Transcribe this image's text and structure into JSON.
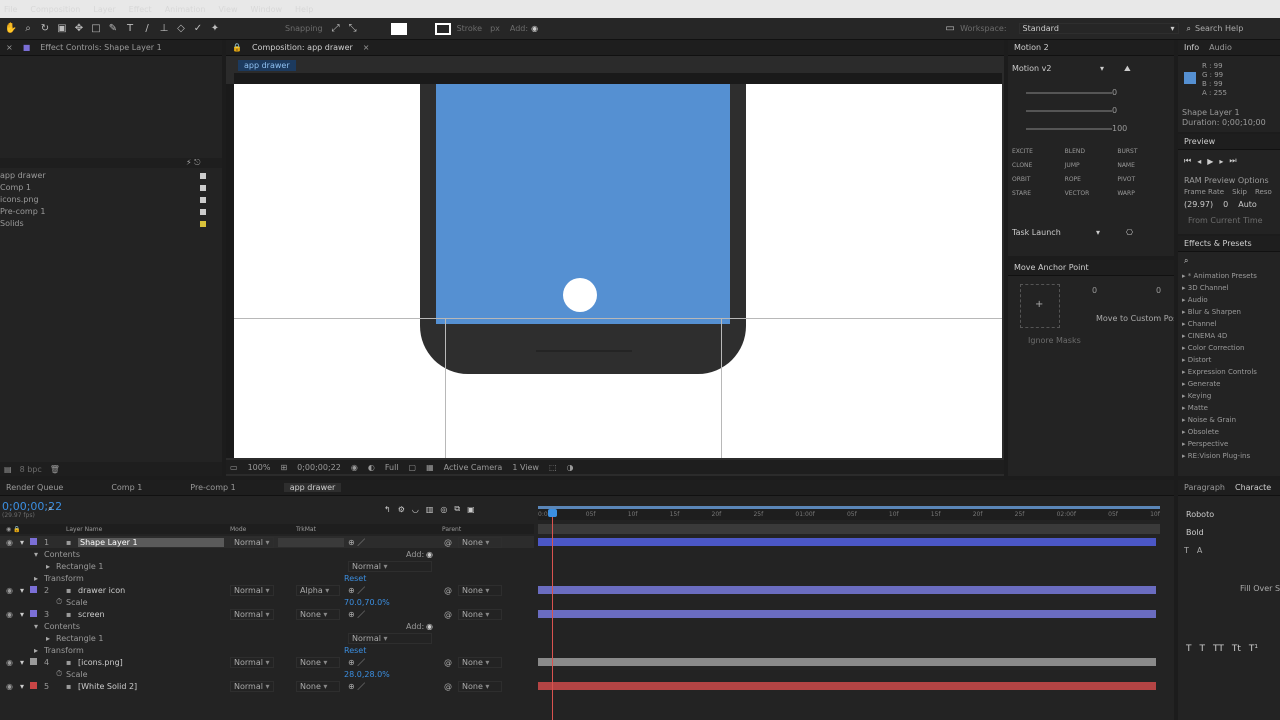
{
  "menu": [
    "File",
    "Composition",
    "Layer",
    "Effect",
    "Animation",
    "View",
    "Window",
    "Help"
  ],
  "toolbar": {
    "workspace_label": "Workspace:",
    "workspace_value": "Standard",
    "search_placeholder": "Search Help",
    "snapping_label": "Snapping",
    "stroke_label": "Stroke",
    "stroke_value": "px",
    "add_label": "Add:"
  },
  "project": {
    "tab": "Effect Controls: Shape Layer 1",
    "items": [
      "app drawer",
      "Comp 1",
      "icons.png",
      "Pre-comp 1",
      "Solids"
    ],
    "bpc": "8 bpc"
  },
  "composition": {
    "tab": "Composition: app drawer",
    "subtab": "app drawer",
    "zoom": "100%",
    "timecode": "0;00;00;22",
    "resolution": "Full",
    "camera": "Active Camera",
    "views": "1 View"
  },
  "motion2": {
    "tab": "Motion 2",
    "preset": "Motion v2",
    "value1": "0",
    "value2": "0",
    "value3": "100",
    "buttons": [
      "EXCITE",
      "BLEND",
      "BURST",
      "CLONE",
      "JUMP",
      "NAME",
      "ORBIT",
      "ROPE",
      "PIVOT",
      "STARE",
      "VECTOR",
      "WARP"
    ],
    "launch": "Task Launch"
  },
  "anchor": {
    "tab": "Move Anchor Point",
    "x": "0",
    "y": "0",
    "move_custom": "Move to Custom Pos",
    "ignore_masks": "Ignore Masks"
  },
  "info": {
    "tab": "Info",
    "tab2": "Audio",
    "r": "R : 99",
    "g": "G : 99",
    "b": "B : 99",
    "a": "A : 255",
    "layer": "Shape Layer 1",
    "duration": "Duration: 0;00;10;00"
  },
  "preview": {
    "tab": "Preview",
    "ram_options": "RAM Preview Options",
    "frame_rate_label": "Frame Rate",
    "skip_label": "Skip",
    "res_label": "Reso",
    "frame_rate": "(29.97)",
    "skip": "0",
    "res": "Auto",
    "from_current": "From Current Time"
  },
  "effects": {
    "tab": "Effects & Presets",
    "items": [
      "* Animation Presets",
      "3D Channel",
      "Audio",
      "Blur & Sharpen",
      "Channel",
      "CINEMA 4D",
      "Color Correction",
      "Distort",
      "Expression Controls",
      "Generate",
      "Keying",
      "Matte",
      "Noise & Grain",
      "Obsolete",
      "Perspective",
      "RE:Vision Plug-ins"
    ]
  },
  "character": {
    "tab": "Paragraph",
    "tab2": "Characte",
    "font": "Roboto",
    "style": "Bold",
    "fill_over": "Fill Over St"
  },
  "timeline": {
    "tabs": [
      "Render Queue",
      "Comp 1",
      "Pre-comp 1",
      "app drawer"
    ],
    "timecode": "0;00;00;22",
    "fps": "(29.97 fps)",
    "col_layer": "Layer Name",
    "col_mode": "Mode",
    "col_trkmat": "TrkMat",
    "col_parent": "Parent",
    "ruler": [
      "0:00f",
      "05f",
      "10f",
      "15f",
      "20f",
      "25f",
      "01:00f",
      "05f",
      "10f",
      "15f",
      "20f",
      "25f",
      "02:00f",
      "05f",
      "10f"
    ],
    "rows": [
      {
        "kind": "layer",
        "num": "1",
        "name": "Shape Layer 1",
        "mode": "Normal",
        "trkmat": "",
        "parent": "None",
        "color": "#7b6fd6",
        "bar": "#4b57c6",
        "selected": true
      },
      {
        "kind": "group",
        "name": "Contents",
        "extra": "Add:"
      },
      {
        "kind": "sub",
        "name": "Rectangle 1",
        "blend": "Normal"
      },
      {
        "kind": "group",
        "name": "Transform",
        "extra": "Reset"
      },
      {
        "kind": "layer",
        "num": "2",
        "name": "drawer icon",
        "mode": "Normal",
        "trkmat": "Alpha",
        "parent": "None",
        "color": "#7b6fd6",
        "bar": "#6a6cc0"
      },
      {
        "kind": "prop",
        "name": "Scale",
        "value": "70.0,70.0%"
      },
      {
        "kind": "layer",
        "num": "3",
        "name": "screen",
        "mode": "Normal",
        "trkmat": "None",
        "parent": "None",
        "color": "#7b6fd6",
        "bar": "#6a6cc0"
      },
      {
        "kind": "group",
        "name": "Contents",
        "extra": "Add:"
      },
      {
        "kind": "sub",
        "name": "Rectangle 1",
        "blend": "Normal"
      },
      {
        "kind": "group",
        "name": "Transform",
        "extra": "Reset"
      },
      {
        "kind": "layer",
        "num": "4",
        "name": "[icons.png]",
        "mode": "Normal",
        "trkmat": "None",
        "parent": "None",
        "color": "#9a9a9a",
        "bar": "#8a8a8a"
      },
      {
        "kind": "prop",
        "name": "Scale",
        "value": "28.0,28.0%"
      },
      {
        "kind": "layer",
        "num": "5",
        "name": "[White Solid 2]",
        "mode": "Normal",
        "trkmat": "None",
        "parent": "None",
        "color": "#c94545",
        "bar": "#b44444"
      }
    ]
  },
  "colors": {
    "screen_blue": "#5590d2",
    "phone_body": "#2e2e2e",
    "accent": "#3b8ee0",
    "playhead": "#d9534f"
  }
}
